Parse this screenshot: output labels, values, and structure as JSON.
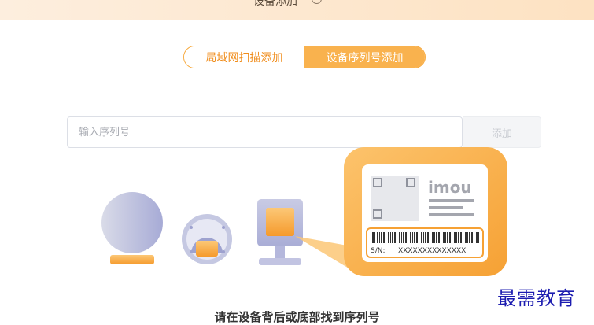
{
  "header": {
    "title": "设备添加"
  },
  "tabs": [
    {
      "label": "局域网扫描添加",
      "active": false
    },
    {
      "label": "设备序列号添加",
      "active": true
    }
  ],
  "serial": {
    "placeholder": "输入序列号",
    "value": "",
    "add_label": "添加"
  },
  "label_card": {
    "brand": "imou",
    "sn_prefix": "S/N:",
    "sn_value": "XXXXXXXXXXXXXX"
  },
  "hint": "请在设备背后或底部找到序列号",
  "watermark": "最需教育",
  "colors": {
    "accent": "#f7a83a",
    "accent_fill": "#f9b24e",
    "device": "#b9bde0"
  },
  "icons": [
    "help-circle-icon",
    "camera-ball-device-icon",
    "camera-dome-device-icon",
    "camera-box-device-icon",
    "device-label-icon"
  ]
}
